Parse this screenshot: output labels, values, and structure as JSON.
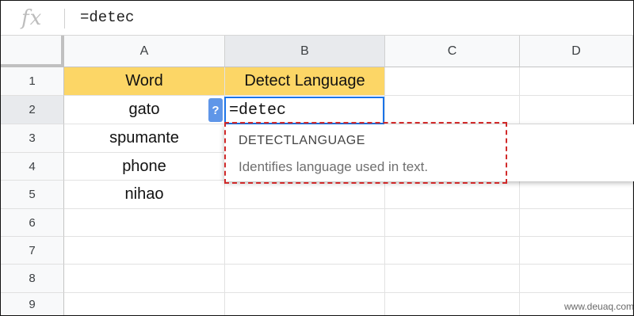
{
  "formula_bar": {
    "fx_label": "fx",
    "formula": "=detec"
  },
  "columns": [
    "A",
    "B",
    "C",
    "D"
  ],
  "rows": [
    "1",
    "2",
    "3",
    "4",
    "5",
    "6",
    "7",
    "8",
    "9"
  ],
  "cells": {
    "A1": "Word",
    "B1": "Detect Language",
    "A2": "gato",
    "A3": "spumante",
    "A4": "phone",
    "A5": "nihao"
  },
  "active_cell": {
    "ref": "B2",
    "value": "=detec"
  },
  "help_badge": "?",
  "autocomplete": {
    "function_name": "DETECTLANGUAGE",
    "description": "Identifies language used in text."
  },
  "watermark": "www.deuaq.com",
  "colors": {
    "header_fill": "#fcd666",
    "active_border": "#1a73e8",
    "annotation": "#d12a2a"
  }
}
